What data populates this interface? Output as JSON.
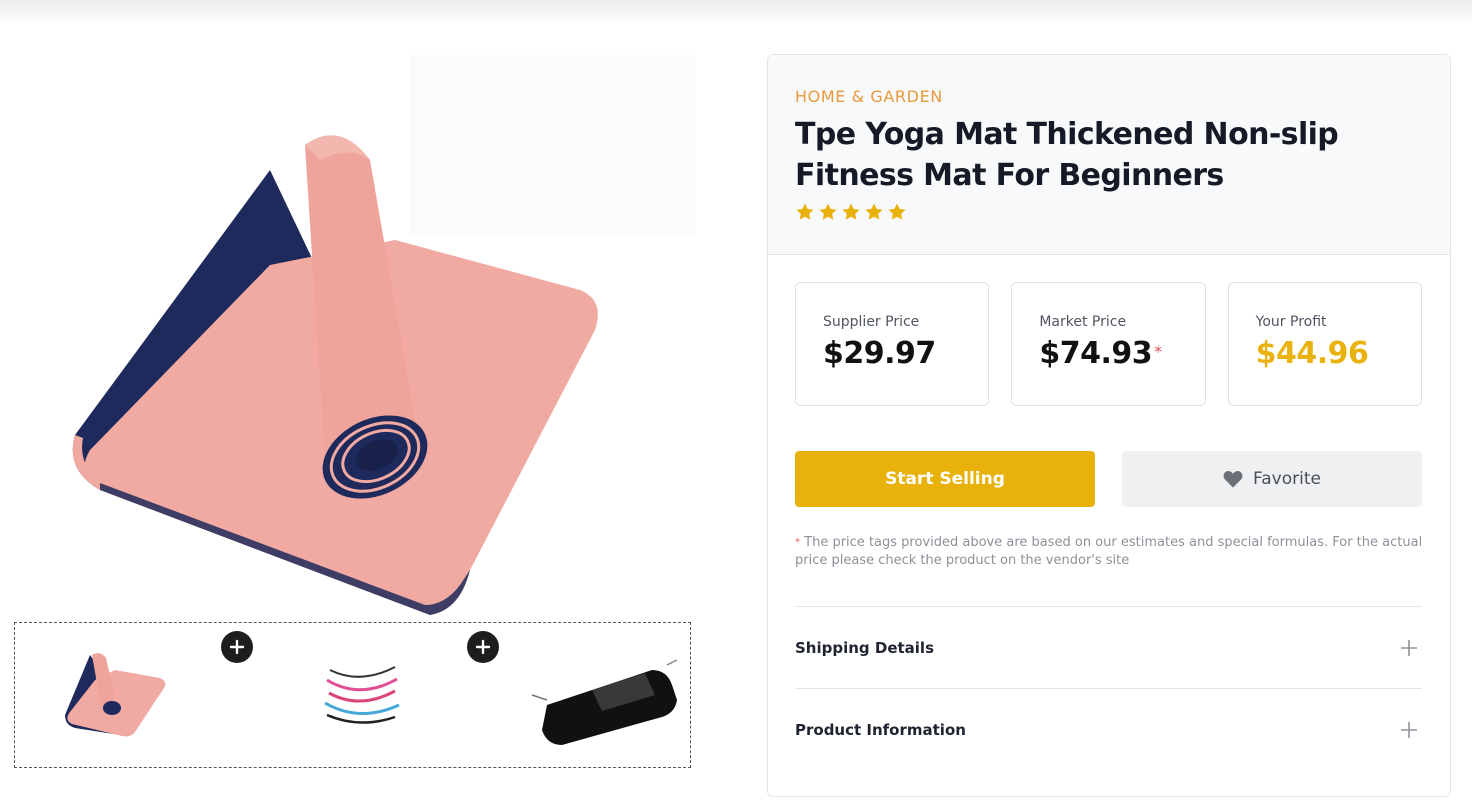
{
  "product": {
    "category": "HOME & GARDEN",
    "title": "Tpe Yoga Mat Thickened Non-slip Fitness Mat For Beginners",
    "rating": 5,
    "max_rating": 5
  },
  "gallery": {
    "main_image": "yoga-mat-main",
    "bundle_items": [
      "yoga-mat",
      "resistance-bands",
      "mesh-carry-bag"
    ]
  },
  "prices": {
    "supplier": {
      "label": "Supplier Price",
      "value": "$29.97"
    },
    "market": {
      "label": "Market Price",
      "value": "$74.93",
      "marker": "*"
    },
    "profit": {
      "label": "Your Profit",
      "value": "$44.96"
    }
  },
  "actions": {
    "start_selling": "Start Selling",
    "favorite": "Favorite"
  },
  "disclaimer": {
    "marker": "*",
    "text": "The price tags provided above are based on our estimates and special formulas. For the actual price please check the product on the vendor's site"
  },
  "accordion": [
    {
      "label": "Shipping Details"
    },
    {
      "label": "Product Information"
    }
  ],
  "colors": {
    "accent": "#e9b20a",
    "category": "#e89a3c",
    "asterisk": "#e8575d",
    "mat_pink": "#f1a8a0",
    "mat_navy": "#1f2a5c"
  }
}
